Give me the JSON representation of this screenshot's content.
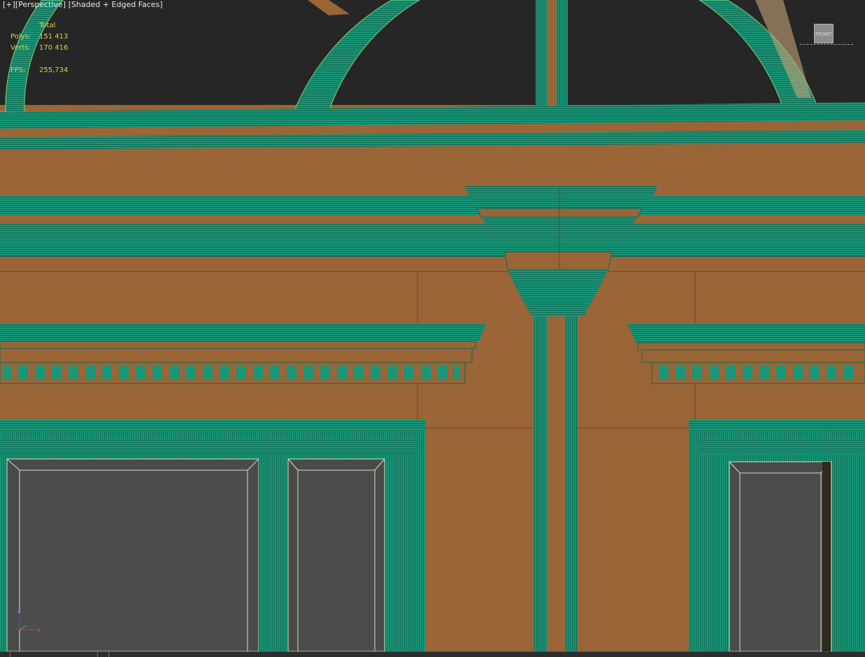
{
  "viewport": {
    "menu": "[+]",
    "view": "[Perspective]",
    "shading": "[Shaded + Edged Faces]"
  },
  "stats": {
    "header": "Total",
    "polys_label": "Polys:",
    "polys_value": "151 413",
    "verts_label": "Verts:",
    "verts_value": "170 416",
    "fps_label": "FPS:",
    "fps_value": "255,734"
  },
  "viewcube": {
    "face": "FRONT"
  },
  "axis": {
    "z": "z",
    "x": "x"
  },
  "colors": {
    "wall": "#9a6537",
    "trim": "#1a9678",
    "trim_dark": "#127a5e",
    "glass": "#4a4a4a",
    "sky": "#262626",
    "stats_text": "#e8d23a"
  }
}
